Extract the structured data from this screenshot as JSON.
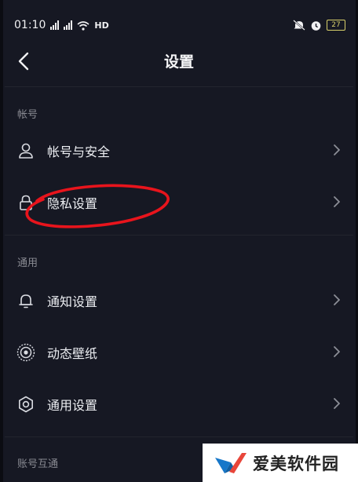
{
  "status_bar": {
    "time": "01:10",
    "network": "HD",
    "battery_level": "27"
  },
  "header": {
    "title": "设置"
  },
  "sections": {
    "account": {
      "title": "帐号",
      "items": [
        {
          "label": "帐号与安全",
          "icon": "user-icon"
        },
        {
          "label": "隐私设置",
          "icon": "lock-icon"
        }
      ]
    },
    "general": {
      "title": "通用",
      "items": [
        {
          "label": "通知设置",
          "icon": "bell-icon"
        },
        {
          "label": "动态壁纸",
          "icon": "live-wallpaper-icon"
        },
        {
          "label": "通用设置",
          "icon": "gear-icon"
        }
      ]
    },
    "interconnect": {
      "title": "账号互通"
    }
  },
  "annotation": {
    "color": "#e8141c"
  },
  "watermark": {
    "text": "爱美软件园",
    "colors": {
      "blue": "#1677c9",
      "red": "#e8463a"
    }
  }
}
